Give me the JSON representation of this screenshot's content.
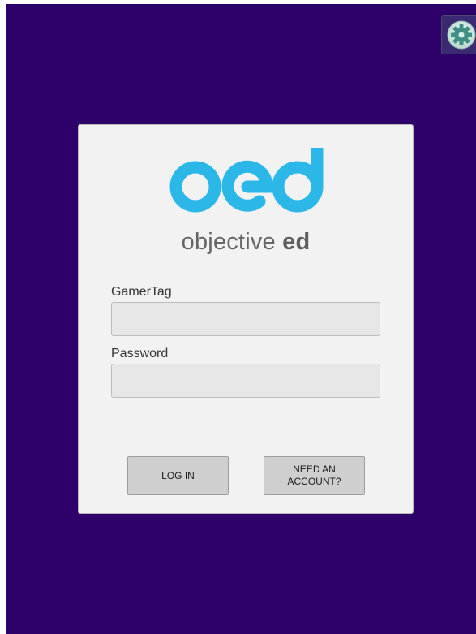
{
  "app": {
    "brand": "oed",
    "tagline_light": "objective",
    "tagline_bold": "ed",
    "accent_color": "#2bb8e8",
    "background_color": "#2d006a"
  },
  "settings": {
    "icon": "gear-icon"
  },
  "form": {
    "gamertag_label": "GamerTag",
    "gamertag_value": "",
    "password_label": "Password",
    "password_value": ""
  },
  "buttons": {
    "login_label": "LOG IN",
    "need_account_label": "NEED AN\nACCOUNT?"
  }
}
